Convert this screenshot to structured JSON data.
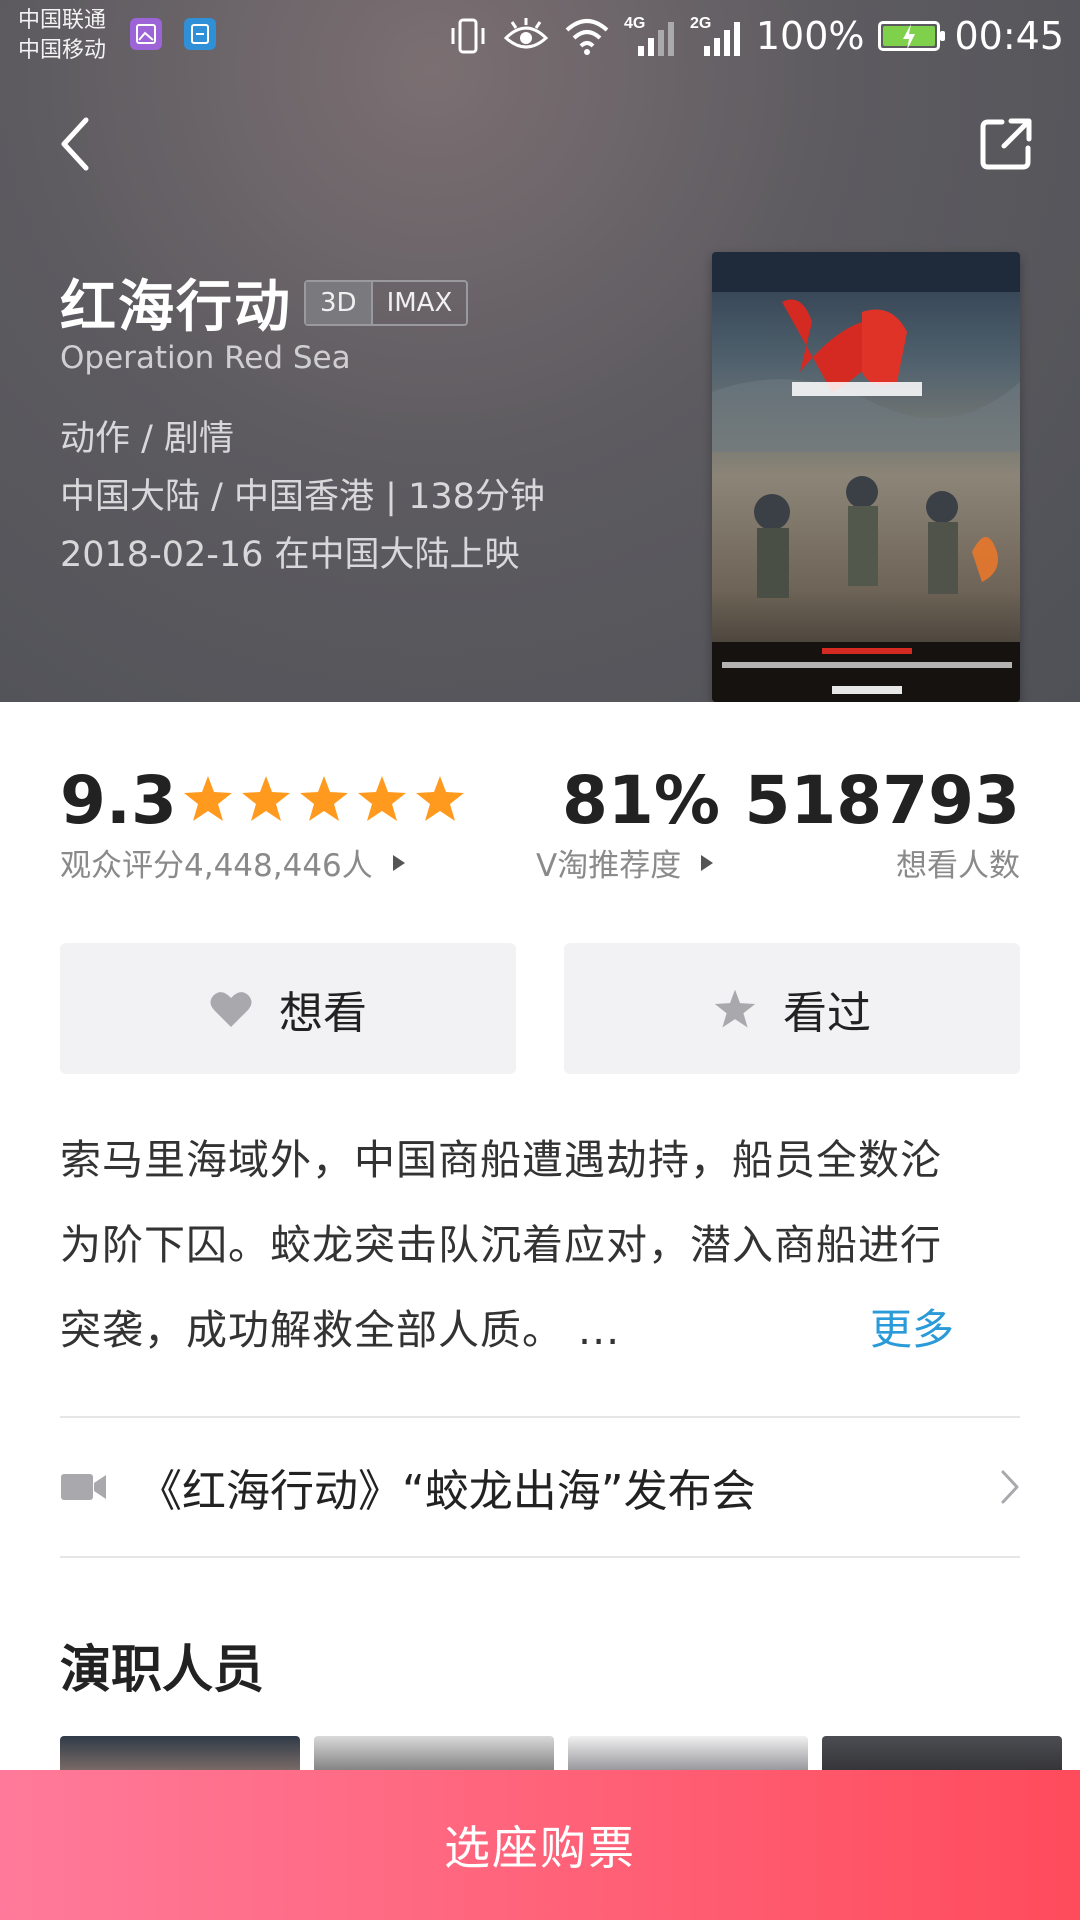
{
  "status_bar": {
    "carrier1": "中国联通",
    "carrier2": "中国移动",
    "net1": "4G",
    "net2": "2G",
    "battery": "100%",
    "time": "00:45"
  },
  "movie": {
    "title": "红海行动",
    "tags": [
      "3D",
      "IMAX"
    ],
    "english_title": "Operation Red Sea",
    "genre": "动作 / 剧情",
    "region_duration": "中国大陆 / 中国香港 | 138分钟",
    "release": "2018-02-16 在中国大陆上映"
  },
  "ratings": {
    "score": "9.3",
    "stars": 5,
    "score_label": "观众评分4,448,446人",
    "recommend_pct": "81%",
    "recommend_label": "V淘推荐度",
    "want_count": "518793",
    "want_label": "想看人数"
  },
  "actions": {
    "want": "想看",
    "seen": "看过"
  },
  "synopsis": {
    "line1": "索马里海域外，中国商船遭遇劫持，船员全数沦",
    "line2": "为阶下囚。蛟龙突击队沉着应对，潜入商船进行",
    "line3": "突袭，成功解救全部人质。 ...",
    "more": "更多"
  },
  "video": {
    "title": "《红海行动》“蛟龙出海”发布会"
  },
  "cast": {
    "section_title": "演职人员"
  },
  "buy": {
    "label": "选座购票"
  },
  "colors": {
    "accent_blue": "#2a9ad9",
    "star_orange": "#ff9a1e",
    "buy_gradient_start": "#ff7a9a",
    "buy_gradient_end": "#ff4b5c"
  },
  "icons": [
    "back-arrow-icon",
    "share-icon",
    "heart-icon",
    "star-icon",
    "video-camera-icon",
    "chevron-right-icon",
    "triangle-right-icon"
  ]
}
